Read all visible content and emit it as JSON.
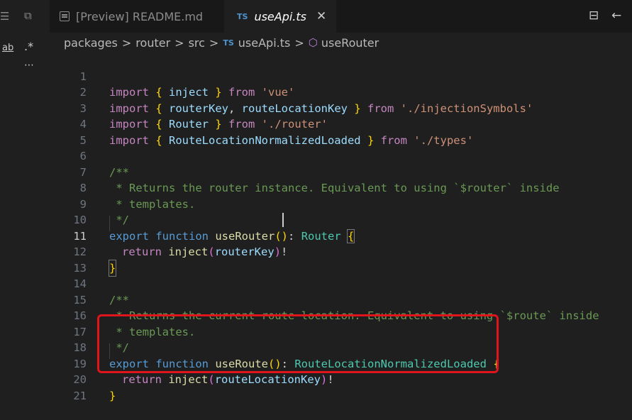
{
  "tabs": {
    "inactive_label": "[Preview] README.md",
    "active_type_badge": "TS",
    "active_label": "useApi.ts",
    "close_glyph": "✕"
  },
  "sidebar": {
    "regex_label": ".*",
    "case_label": "ab",
    "more_label": "⋯"
  },
  "breadcrumb": {
    "segments": [
      "packages",
      "router",
      "src"
    ],
    "file_badge": "TS",
    "file": "useApi.ts",
    "symbol": "useRouter",
    "separator": ">"
  },
  "editor": {
    "line_numbers": [
      "1",
      "2",
      "3",
      "4",
      "5",
      "6",
      "7",
      "8",
      "9",
      "10",
      "11",
      "12",
      "13",
      "14",
      "15",
      "16",
      "17",
      "18",
      "19",
      "20",
      "21"
    ],
    "current_line": "11",
    "l1": [
      "import",
      " { ",
      "inject",
      " } ",
      "from",
      " ",
      "'vue'"
    ],
    "l2": [
      "import",
      " { ",
      "routerKey",
      ", ",
      "routeLocationKey",
      " } ",
      "from",
      " ",
      "'./injectionSymbols'"
    ],
    "l3": [
      "import",
      " { ",
      "Router",
      " } ",
      "from",
      " ",
      "'./router'"
    ],
    "l4": [
      "import",
      " { ",
      "RouteLocationNormalizedLoaded",
      " } ",
      "from",
      " ",
      "'./types'"
    ],
    "l6": "/**",
    "l7": " * Returns the router instance. Equivalent to using `$router` inside",
    "l8": " * templates.",
    "l9": " */",
    "l10": [
      "export",
      " ",
      "function",
      " ",
      "useRouter",
      "()",
      ": ",
      "Router",
      " ",
      "{"
    ],
    "l11": [
      "return",
      " ",
      "inject",
      "(",
      "routerKey",
      ")",
      "!"
    ],
    "l12": "}",
    "l14": "/**",
    "l15": " * Returns the current route location. Equivalent to using `$route` inside",
    "l16": " * templates.",
    "l17": " */",
    "l18": [
      "export",
      " ",
      "function",
      " ",
      "useRoute",
      "()",
      ": ",
      "RouteLocationNormalizedLoaded",
      " ",
      "{"
    ],
    "l19": [
      "return",
      " ",
      "inject",
      "(",
      "routeLocationKey",
      ")",
      "!"
    ],
    "l20": "}"
  },
  "colors": {
    "highlight_border": "#e0141b",
    "keyword": "#569cd6",
    "control_keyword": "#c586c0",
    "function": "#dcdcaa",
    "variable": "#9cdcfe",
    "type": "#4ec9b0",
    "string": "#ce9178",
    "comment": "#6a9955"
  }
}
